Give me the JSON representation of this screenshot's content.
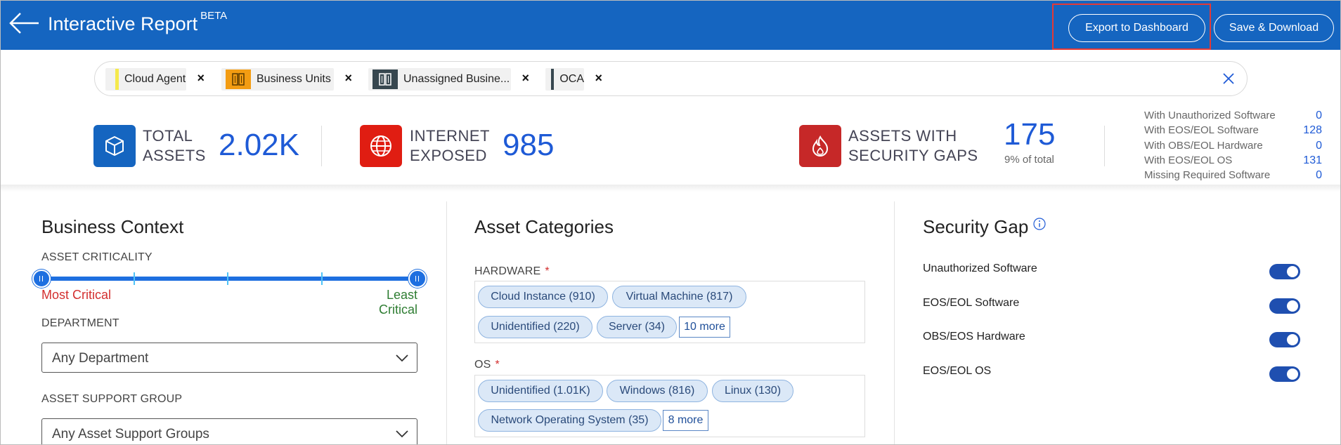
{
  "header": {
    "title": "Interactive Report",
    "badge": "BETA",
    "export_label": "Export to Dashboard",
    "save_label": "Save & Download",
    "back_icon": "arrow-left-icon"
  },
  "filters": [
    {
      "label": "Cloud Agent",
      "marker_color": "#f5e94c"
    },
    {
      "label": "Business Units",
      "icon": "building-icon",
      "icon_color": "#f39c12"
    },
    {
      "label": "Unassigned Busine...",
      "icon": "building-icon",
      "icon_color": "#37474f"
    },
    {
      "label": "OCA",
      "marker_color": "#37474f"
    }
  ],
  "filter_remove": "×",
  "stats": {
    "total": {
      "line1": "TOTAL",
      "line2": "ASSETS",
      "value": "2.02K",
      "icon": "cube-icon"
    },
    "internet": {
      "line1": "INTERNET",
      "line2": "EXPOSED",
      "value": "985",
      "icon": "globe-icon"
    },
    "gaps": {
      "line1": "ASSETS WITH",
      "line2": "SECURITY GAPS",
      "value": "175",
      "sub": "9% of total",
      "icon": "flame-icon"
    },
    "gap_breakdown": [
      {
        "label": "With Unauthorized Software",
        "value": "0"
      },
      {
        "label": "With EOS/EOL Software",
        "value": "128"
      },
      {
        "label": "With OBS/EOL Hardware",
        "value": "0"
      },
      {
        "label": "With EOS/EOL OS",
        "value": "131"
      },
      {
        "label": "Missing Required Software",
        "value": "0"
      }
    ]
  },
  "business": {
    "title": "Business Context",
    "criticality_label": "ASSET CRITICALITY",
    "most": "Most Critical",
    "least": "Least Critical",
    "department_label": "DEPARTMENT",
    "department_value": "Any Department",
    "support_label": "ASSET SUPPORT GROUP",
    "support_value": "Any Asset Support Groups"
  },
  "categories": {
    "title": "Asset Categories",
    "hardware_label": "HARDWARE",
    "hardware": [
      "Cloud Instance (910)",
      "Virtual Machine (817)",
      "Unidentified (220)",
      "Server (34)"
    ],
    "hardware_more": "10 more",
    "os_label": "OS",
    "os": [
      "Unidentified (1.01K)",
      "Windows (816)",
      "Linux (130)",
      "Network Operating System (35)"
    ],
    "os_more": "8 more",
    "required_mark": "*"
  },
  "security_gap": {
    "title": "Security Gap",
    "toggles": [
      {
        "label": "Unauthorized Software",
        "on": true
      },
      {
        "label": "EOS/EOL Software",
        "on": true
      },
      {
        "label": "OBS/EOS Hardware",
        "on": true
      },
      {
        "label": "EOS/EOL OS",
        "on": true
      }
    ]
  },
  "colors": {
    "header_bg": "#1565c0",
    "accent": "#1e5ad6",
    "critical": "#d32f2f",
    "least": "#2e7d32"
  }
}
